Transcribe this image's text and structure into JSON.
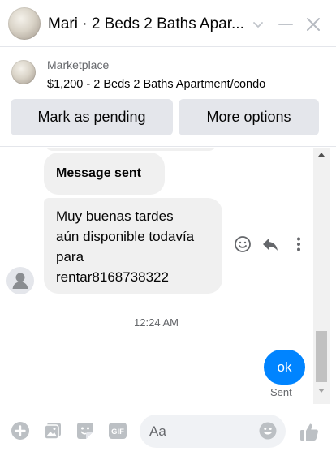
{
  "header": {
    "title": "Mari · 2 Beds 2 Baths Apar...",
    "icons": [
      "listing-avatar",
      "chevron-down-icon",
      "minimize-icon",
      "close-icon"
    ]
  },
  "listing": {
    "source": "Marketplace",
    "text": "$1,200 - 2 Beds 2 Baths Apartment/condo",
    "mark_pending_label": "Mark as pending",
    "more_options_label": "More options"
  },
  "thread": {
    "messages": [
      {
        "from": "other",
        "text": "Message sent"
      },
      {
        "from": "other",
        "text": "Muy buenas tardes\naún disponible todavía\npara\nrentar8168738322"
      }
    ],
    "timestamp": "12:24 AM",
    "own_message": "ok",
    "own_status": "Sent",
    "message_actions": [
      "emoji-reaction-icon",
      "reply-icon",
      "more-options-icon"
    ]
  },
  "composer": {
    "placeholder": "Aa",
    "icons": [
      "plus-icon",
      "gallery-icon",
      "sticker-icon",
      "gif-icon",
      "emoji-icon",
      "like-icon"
    ]
  },
  "colors": {
    "accent": "#0084ff",
    "icon": "#606770",
    "bubble": "#f0f0f0"
  }
}
